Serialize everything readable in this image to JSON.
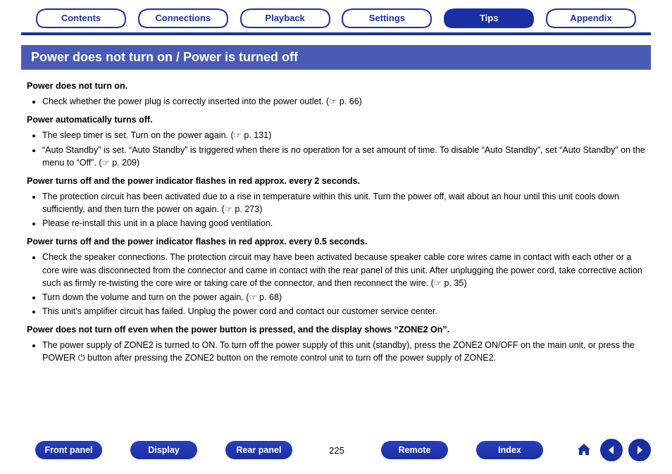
{
  "tabs": [
    {
      "label": "Contents",
      "active": false
    },
    {
      "label": "Connections",
      "active": false
    },
    {
      "label": "Playback",
      "active": false
    },
    {
      "label": "Settings",
      "active": false
    },
    {
      "label": "Tips",
      "active": true
    },
    {
      "label": "Appendix",
      "active": false
    }
  ],
  "band_title": "Power does not turn on / Power is turned off",
  "sections": [
    {
      "title": "Power does not turn on.",
      "items": [
        {
          "text": "Check whether the power plug is correctly inserted into the power outlet.",
          "ref": "p. 66"
        }
      ]
    },
    {
      "title": "Power automatically turns off.",
      "items": [
        {
          "text": "The sleep timer is set. Turn on the power again.",
          "ref": "p. 131"
        },
        {
          "text": "“Auto Standby” is set. “Auto Standby” is triggered when there is no operation for a set amount of time. To disable “Auto Standby”, set “Auto Standby” on the menu to “Off”.",
          "ref": "p. 209"
        }
      ]
    },
    {
      "title": "Power turns off and the power indicator flashes in red approx. every 2 seconds.",
      "items": [
        {
          "text": "The protection circuit has been activated due to a rise in temperature within this unit. Turn the power off, wait about an hour until this unit cools down sufficiently, and then turn the power on again.",
          "ref": "p. 273"
        },
        {
          "text": "Please re-install this unit in a place having good ventilation."
        }
      ]
    },
    {
      "title": "Power turns off and the power indicator flashes in red approx. every 0.5 seconds.",
      "items": [
        {
          "text": "Check the speaker connections. The protection circuit may have been activated because speaker cable core wires came in contact with each other or a core wire was disconnected from the connector and came in contact with the rear panel of this unit. After unplugging the power cord, take corrective action such as firmly re-twisting the core wire or taking care of the connector, and then reconnect the wire.",
          "ref": "p. 35"
        },
        {
          "text": "Turn down the volume and turn on the power again.",
          "ref": "p. 68"
        },
        {
          "text": "This unit's amplifier circuit has failed. Unplug the power cord and contact our customer service center."
        }
      ]
    },
    {
      "title": "Power does not turn off even when the power button is pressed, and the display shows “ZONE2 On”.",
      "items": [
        {
          "text": "The power supply of ZONE2 is turned to ON. To turn off the power supply of this unit (standby), press the ZONE2 ON/OFF on the main unit, or press the POWER ⏻ button after pressing the ZONE2 button on the remote control unit to turn off the power supply of ZONE2."
        }
      ]
    }
  ],
  "bottom_links": [
    "Front panel",
    "Display",
    "Rear panel",
    "Remote",
    "Index"
  ],
  "page_number": "225"
}
